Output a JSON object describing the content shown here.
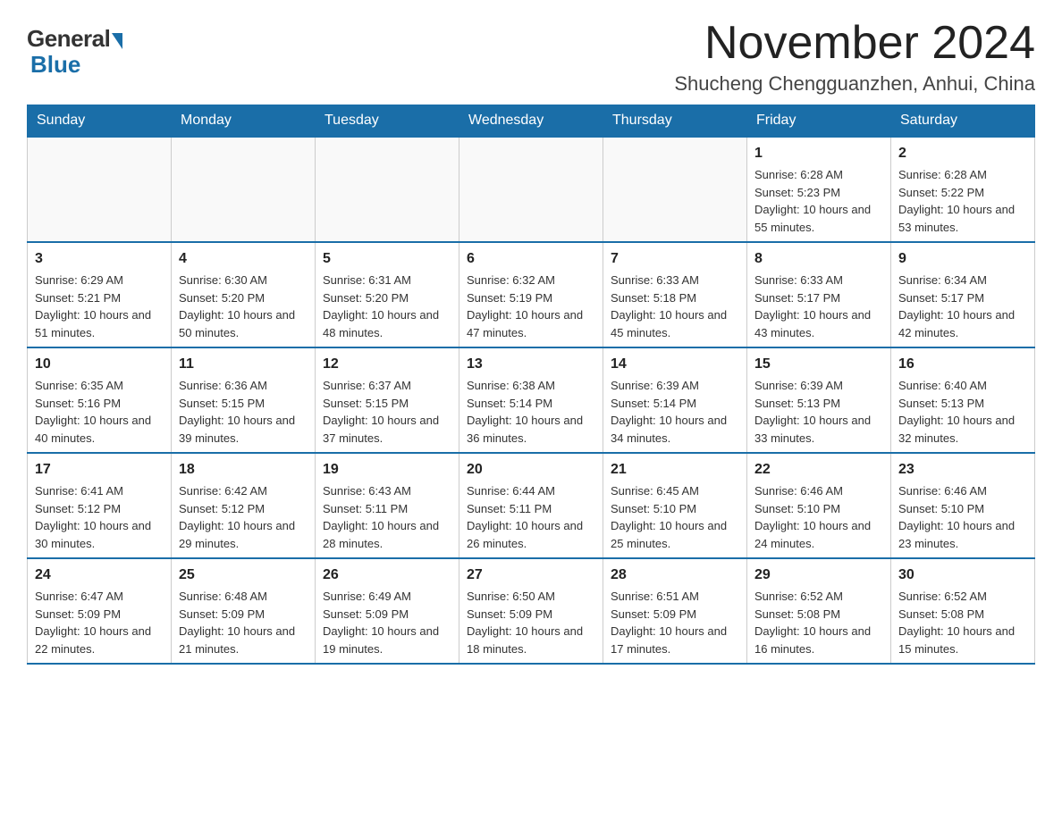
{
  "header": {
    "logo_general": "General",
    "logo_blue": "Blue",
    "month_title": "November 2024",
    "location": "Shucheng Chengguanzhen, Anhui, China"
  },
  "weekdays": [
    "Sunday",
    "Monday",
    "Tuesday",
    "Wednesday",
    "Thursday",
    "Friday",
    "Saturday"
  ],
  "weeks": [
    [
      {
        "day": "",
        "info": ""
      },
      {
        "day": "",
        "info": ""
      },
      {
        "day": "",
        "info": ""
      },
      {
        "day": "",
        "info": ""
      },
      {
        "day": "",
        "info": ""
      },
      {
        "day": "1",
        "info": "Sunrise: 6:28 AM\nSunset: 5:23 PM\nDaylight: 10 hours and 55 minutes."
      },
      {
        "day": "2",
        "info": "Sunrise: 6:28 AM\nSunset: 5:22 PM\nDaylight: 10 hours and 53 minutes."
      }
    ],
    [
      {
        "day": "3",
        "info": "Sunrise: 6:29 AM\nSunset: 5:21 PM\nDaylight: 10 hours and 51 minutes."
      },
      {
        "day": "4",
        "info": "Sunrise: 6:30 AM\nSunset: 5:20 PM\nDaylight: 10 hours and 50 minutes."
      },
      {
        "day": "5",
        "info": "Sunrise: 6:31 AM\nSunset: 5:20 PM\nDaylight: 10 hours and 48 minutes."
      },
      {
        "day": "6",
        "info": "Sunrise: 6:32 AM\nSunset: 5:19 PM\nDaylight: 10 hours and 47 minutes."
      },
      {
        "day": "7",
        "info": "Sunrise: 6:33 AM\nSunset: 5:18 PM\nDaylight: 10 hours and 45 minutes."
      },
      {
        "day": "8",
        "info": "Sunrise: 6:33 AM\nSunset: 5:17 PM\nDaylight: 10 hours and 43 minutes."
      },
      {
        "day": "9",
        "info": "Sunrise: 6:34 AM\nSunset: 5:17 PM\nDaylight: 10 hours and 42 minutes."
      }
    ],
    [
      {
        "day": "10",
        "info": "Sunrise: 6:35 AM\nSunset: 5:16 PM\nDaylight: 10 hours and 40 minutes."
      },
      {
        "day": "11",
        "info": "Sunrise: 6:36 AM\nSunset: 5:15 PM\nDaylight: 10 hours and 39 minutes."
      },
      {
        "day": "12",
        "info": "Sunrise: 6:37 AM\nSunset: 5:15 PM\nDaylight: 10 hours and 37 minutes."
      },
      {
        "day": "13",
        "info": "Sunrise: 6:38 AM\nSunset: 5:14 PM\nDaylight: 10 hours and 36 minutes."
      },
      {
        "day": "14",
        "info": "Sunrise: 6:39 AM\nSunset: 5:14 PM\nDaylight: 10 hours and 34 minutes."
      },
      {
        "day": "15",
        "info": "Sunrise: 6:39 AM\nSunset: 5:13 PM\nDaylight: 10 hours and 33 minutes."
      },
      {
        "day": "16",
        "info": "Sunrise: 6:40 AM\nSunset: 5:13 PM\nDaylight: 10 hours and 32 minutes."
      }
    ],
    [
      {
        "day": "17",
        "info": "Sunrise: 6:41 AM\nSunset: 5:12 PM\nDaylight: 10 hours and 30 minutes."
      },
      {
        "day": "18",
        "info": "Sunrise: 6:42 AM\nSunset: 5:12 PM\nDaylight: 10 hours and 29 minutes."
      },
      {
        "day": "19",
        "info": "Sunrise: 6:43 AM\nSunset: 5:11 PM\nDaylight: 10 hours and 28 minutes."
      },
      {
        "day": "20",
        "info": "Sunrise: 6:44 AM\nSunset: 5:11 PM\nDaylight: 10 hours and 26 minutes."
      },
      {
        "day": "21",
        "info": "Sunrise: 6:45 AM\nSunset: 5:10 PM\nDaylight: 10 hours and 25 minutes."
      },
      {
        "day": "22",
        "info": "Sunrise: 6:46 AM\nSunset: 5:10 PM\nDaylight: 10 hours and 24 minutes."
      },
      {
        "day": "23",
        "info": "Sunrise: 6:46 AM\nSunset: 5:10 PM\nDaylight: 10 hours and 23 minutes."
      }
    ],
    [
      {
        "day": "24",
        "info": "Sunrise: 6:47 AM\nSunset: 5:09 PM\nDaylight: 10 hours and 22 minutes."
      },
      {
        "day": "25",
        "info": "Sunrise: 6:48 AM\nSunset: 5:09 PM\nDaylight: 10 hours and 21 minutes."
      },
      {
        "day": "26",
        "info": "Sunrise: 6:49 AM\nSunset: 5:09 PM\nDaylight: 10 hours and 19 minutes."
      },
      {
        "day": "27",
        "info": "Sunrise: 6:50 AM\nSunset: 5:09 PM\nDaylight: 10 hours and 18 minutes."
      },
      {
        "day": "28",
        "info": "Sunrise: 6:51 AM\nSunset: 5:09 PM\nDaylight: 10 hours and 17 minutes."
      },
      {
        "day": "29",
        "info": "Sunrise: 6:52 AM\nSunset: 5:08 PM\nDaylight: 10 hours and 16 minutes."
      },
      {
        "day": "30",
        "info": "Sunrise: 6:52 AM\nSunset: 5:08 PM\nDaylight: 10 hours and 15 minutes."
      }
    ]
  ]
}
